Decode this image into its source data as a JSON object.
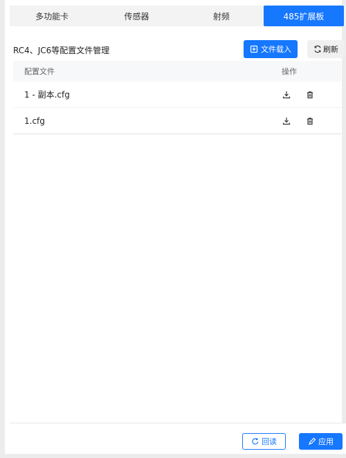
{
  "tabs": [
    {
      "label": "多功能卡",
      "active": false
    },
    {
      "label": "传感器",
      "active": false
    },
    {
      "label": "射频",
      "active": false
    },
    {
      "label": "485扩展板",
      "active": true
    }
  ],
  "header": {
    "title": "RC4、JC6等配置文件管理",
    "load_label": "文件载入",
    "refresh_label": "刷新"
  },
  "table": {
    "columns": {
      "file": "配置文件",
      "ops": "操作"
    },
    "rows": [
      {
        "file": "1 - 副本.cfg"
      },
      {
        "file": "1.cfg"
      }
    ]
  },
  "footer": {
    "readback_label": "回读",
    "apply_label": "应用"
  },
  "colors": {
    "accent": "#1677ff",
    "tab_bg": "#f3f3f3",
    "header_bg": "#f7f8fa"
  },
  "icons": {
    "load": "import-icon",
    "refresh": "refresh-icon",
    "download": "download-icon",
    "delete": "trash-icon",
    "readback": "readback-icon",
    "apply": "edit-icon"
  }
}
